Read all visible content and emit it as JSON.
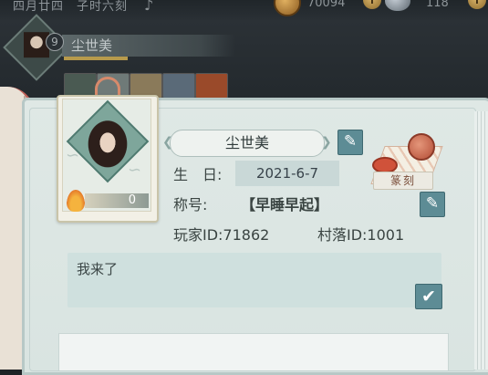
{
  "top_bar": {
    "date": "四月廿四　子时六刻",
    "coin_value": "70094",
    "gem_value": "118",
    "plus_label": "+"
  },
  "background_card": {
    "level": "9",
    "name": "尘世美"
  },
  "profile": {
    "name": "尘世美",
    "likes": "0",
    "birthday_label": "生　日:",
    "birthday_value": "2021-6-7",
    "title_label": "称号:",
    "title_value": "【早睡早起】",
    "player_id_label": "玩家ID:71862",
    "village_id_label": "村落ID:1001",
    "stamp_label": "篆刻",
    "signature": "我来了"
  },
  "icons": {
    "edit": "pencil-icon",
    "confirm": "checkmark-icon",
    "coin": "coin-icon",
    "gem": "gem-icon",
    "flame": "flame-icon",
    "sound": "sound-icon"
  },
  "colors": {
    "button": "#5d8c95",
    "panel": "#dfe8e5",
    "seal": "#b34d36"
  }
}
